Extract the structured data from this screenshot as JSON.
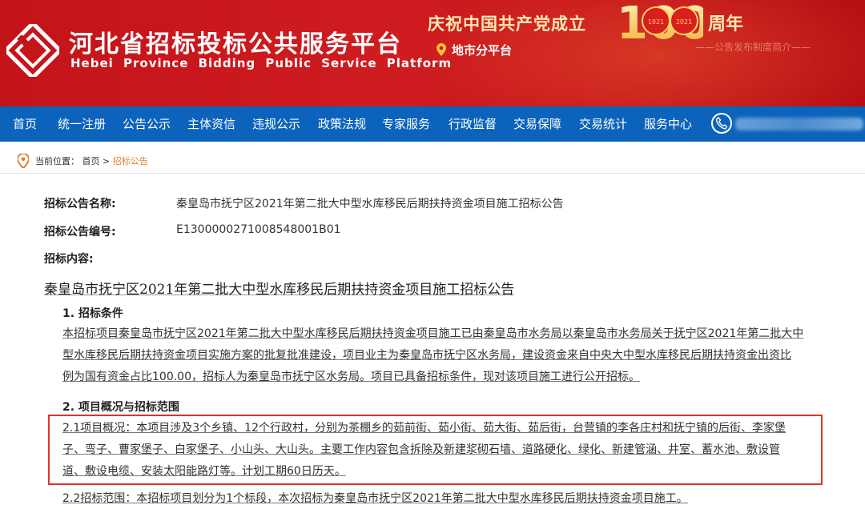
{
  "header": {
    "title_cn": "河北省招标投标公共服务平台",
    "title_en": "Hebei Province Bidding Public Service Platform",
    "slogan": "庆祝中国共产党成立",
    "badge_number": "100",
    "badge_years": [
      "1921",
      "2021"
    ],
    "anniversary": "周年",
    "sub_platform": "地市分平台",
    "right_note": "——公告发布制度简介——",
    "brand_color": "#c3141a"
  },
  "nav": {
    "items": [
      "首页",
      "统一注册",
      "公告公示",
      "主体资信",
      "违规公示",
      "政策法规",
      "专家服务",
      "行政监督",
      "交易保障",
      "交易统计",
      "服务中心"
    ],
    "color": "#0c63bb"
  },
  "breadcrumb": {
    "prefix": "当前位置：",
    "home": "首页",
    "separator": ">",
    "current": "招标公告"
  },
  "notice": {
    "name_label": "招标公告名称:",
    "name_value": "秦皇岛市抚宁区2021年第二批大中型水库移民后期扶持资金项目施工招标公告",
    "id_label": "招标公告编号:",
    "id_value": "E1300000271008548001B01",
    "content_label": "招标内容:"
  },
  "article": {
    "title": "秦皇岛市抚宁区2021年第二批大中型水库移民后期扶持资金项目施工招标公告",
    "section1": "1. 招标条件",
    "para1_lines": [
      "本招标项目秦皇岛市抚宁区2021年第二批大中型水库移民后期扶持资金项目施工已由秦皇岛市水务局以秦皇岛市水务局关于抚宁区2021年第二批大中",
      "型水库移民后期扶持资金项目实施方案的批复批准建设，项目业主为秦皇岛市抚宁区水务局，建设资金来自中央大中型水库移民后期扶持资金出资比",
      "例为国有资金占比100.00，招标人为秦皇岛市抚宁区水务局。项目已具备招标条件，现对该项目施工进行公开招标。"
    ],
    "section2": "2. 项目概况与招标范围",
    "para21_lines": [
      "2.1项目概况：本项目涉及3个乡镇、12个行政村，分别为茶棚乡的茹前街、茹小街、茹大街、茹后街，台营镇的李各庄村和抚宁镇的后街、李家堡",
      "子、弯子、曹家堡子、白家堡子、小山头、大山头。主要工作内容包含拆除及新建浆砌石墙、道路硬化、绿化、新建管涵、井室、蓄水池、敷设管",
      "道、敷设电缆、安装太阳能路灯等。计划工期60日历天。"
    ],
    "para22": "2.2招标范围：本招标项目划分为1个标段，本次招标为秦皇岛市抚宁区2021年第二批大中型水库移民后期扶持资金项目施工。",
    "highlight_color": "#e4322b"
  }
}
